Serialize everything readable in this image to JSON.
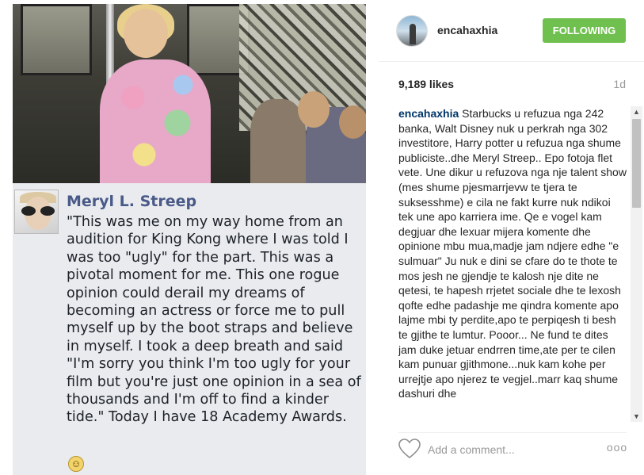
{
  "post": {
    "fb_name": "Meryl L. Streep",
    "fb_quote": "\"This was me on my way home from an\naudition for King Kong where I was told I\nwas too \"ugly\" for the part. This was a\npivotal moment for me. This one rogue\nopinion could derail my dreams of\nbecoming an actress or force me to pull\nmyself up by the boot straps and believe\nin myself. I took a deep breath and said\n\"I'm sorry you think I'm too ugly for your\nfilm but you're just one opinion in a sea of\nthousands and I'm off to find a kinder\ntide.\" Today I have 18 Academy Awards.",
    "emoji": "☺"
  },
  "header": {
    "username": "encahaxhia",
    "follow_label": "FOLLOWING"
  },
  "stats": {
    "likes": "9,189 likes",
    "age": "1d"
  },
  "caption": {
    "user": "encahaxhia",
    "text": " Starbucks u refuzua nga 242 banka, Walt Disney nuk u perkrah nga 302 investitore, Harry potter u refuzua nga shume publiciste..dhe Meryl Streep.. Epo fotoja flet vete. Une dikur u refuzova nga nje talent show (mes shume pjesmarrjevw te tjera te suksesshme) e cila ne fakt kurre nuk ndikoi tek une apo karriera ime. Qe e vogel kam degjuar dhe lexuar mijera komente dhe opinione mbu mua,madje jam ndjere edhe \"e sulmuar\" Ju nuk e dini se cfare do te thote te mos jesh ne gjendje te kalosh nje dite ne qetesi, te hapesh rrjetet sociale dhe te lexosh qofte edhe padashje me qindra komente apo lajme mbi ty perdite,apo te perpiqesh ti besh te gjithe te lumtur. Pooor... Ne fund te dites jam duke jetuar endrren time,ate per te cilen kam punuar gjithmone...nuk kam kohe per urrejtje apo njerez te vegjel..marr kaq shume dashuri dhe"
  },
  "footer": {
    "comment_placeholder": "Add a comment...",
    "more_label": "ooo"
  },
  "icons": {
    "heart": "heart-icon",
    "more": "more-options-icon",
    "scroll_up": "▲",
    "scroll_down": "▼"
  },
  "colors": {
    "follow_button": "#70c050",
    "username_link": "#003569",
    "muted": "#999999",
    "fb_name": "#4a5a88"
  }
}
